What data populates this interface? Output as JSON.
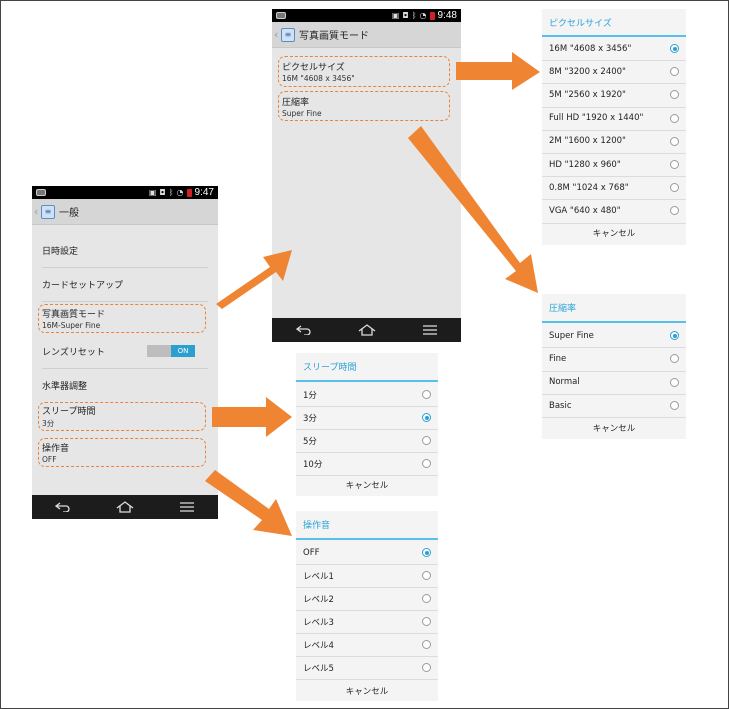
{
  "colors": {
    "accent": "#2aa3d8",
    "highlight": "#e8843a",
    "arrow": "#ef8533"
  },
  "phone_general": {
    "status_time": "9:47",
    "title": "一般",
    "items": [
      {
        "title": "日時設定"
      },
      {
        "title": "カードセットアップ"
      },
      {
        "title": "写真画質モード",
        "subtitle": "16M-Super Fine"
      },
      {
        "title": "レンズリセット",
        "toggle": "ON"
      },
      {
        "title": "水準器調整"
      },
      {
        "title": "スリープ時間",
        "subtitle": "3分"
      },
      {
        "title": "操作音",
        "subtitle": "OFF"
      }
    ]
  },
  "phone_photo": {
    "status_time": "9:48",
    "title": "写真画質モード",
    "items": [
      {
        "title": "ピクセルサイズ",
        "subtitle": "16M \"4608 x 3456\""
      },
      {
        "title": "圧縮率",
        "subtitle": "Super Fine"
      }
    ]
  },
  "dialog_pixel": {
    "title": "ピクセルサイズ",
    "options": [
      "16M \"4608 x 3456\"",
      "8M \"3200 x 2400\"",
      "5M \"2560 x 1920\"",
      "Full HD \"1920 x 1440\"",
      "2M \"1600 x 1200\"",
      "HD \"1280 x 960\"",
      "0.8M \"1024 x 768\"",
      "VGA \"640 x 480\""
    ],
    "selected": 0,
    "cancel": "キャンセル"
  },
  "dialog_compress": {
    "title": "圧縮率",
    "options": [
      "Super Fine",
      "Fine",
      "Normal",
      "Basic"
    ],
    "selected": 0,
    "cancel": "キャンセル"
  },
  "dialog_sleep": {
    "title": "スリープ時間",
    "options": [
      "1分",
      "3分",
      "5分",
      "10分"
    ],
    "selected": 1,
    "cancel": "キャンセル"
  },
  "dialog_sound": {
    "title": "操作音",
    "options": [
      "OFF",
      "レベル1",
      "レベル2",
      "レベル3",
      "レベル4",
      "レベル5"
    ],
    "selected": 0,
    "cancel": "キャンセル"
  }
}
